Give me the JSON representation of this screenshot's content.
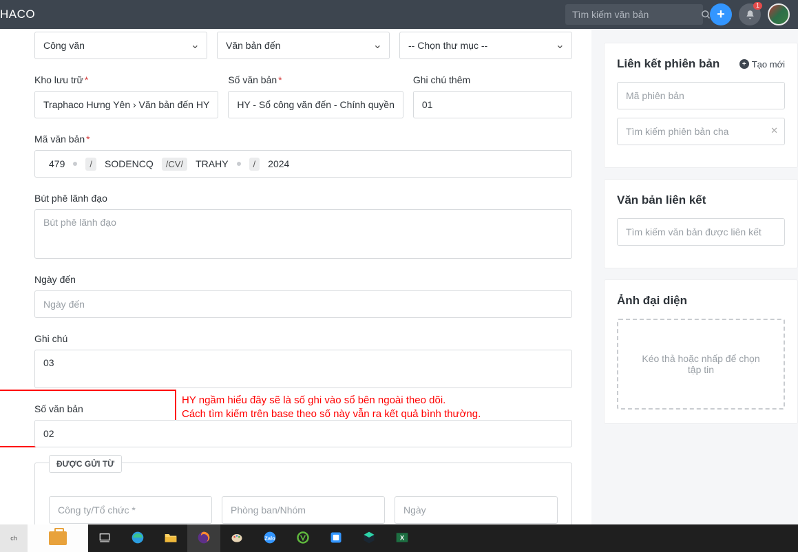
{
  "header": {
    "brand": "HACO",
    "search_placeholder": "Tìm kiếm văn bản",
    "notification_count": "1"
  },
  "form": {
    "type_select": "Công văn",
    "direction_select": "Văn bản đến",
    "folder_placeholder": "-- Chọn thư mục --",
    "storage_label": "Kho lưu trữ",
    "storage_value": "Traphaco Hưng Yên › Văn bản đến HY",
    "docnum_label": "Số văn bản",
    "docnum_value": "HY - Sổ công văn đến - Chính quyền",
    "extra_note_label": "Ghi chú thêm",
    "extra_note_value": "01",
    "code_label": "Mã văn bản",
    "code": {
      "p1": "479",
      "s1": "/",
      "p2": "SODENCQ",
      "s2": "/CV/",
      "p3": "TRAHY",
      "s3": "/",
      "p4": "2024"
    },
    "leader_label": "Bút phê lãnh đạo",
    "leader_placeholder": "Bút phê lãnh đạo",
    "arrival_label": "Ngày đến",
    "arrival_placeholder": "Ngày đến",
    "note_label": "Ghi chú",
    "note_value": "03",
    "svb_label": "Số văn bản",
    "svb_value": "02",
    "sent_from_tab": "ĐƯỢC GỬI TỪ",
    "sent_from_company": "Công ty/Tổ chức *",
    "sent_from_dept": "Phòng ban/Nhóm",
    "sent_from_date": "Ngày"
  },
  "annotation": {
    "line1": "HY ngầm hiểu đây sẽ là số ghi vào sổ bên ngoài theo dõi.",
    "line2": "Cách tìm kiếm trên base theo số này vẫn ra kết quả bình thường."
  },
  "side": {
    "version_title": "Liên kết phiên bản",
    "version_create": "Tạo mới",
    "version_code_ph": "Mã phiên bản",
    "version_parent_ph": "Tìm kiếm phiên bản cha",
    "linked_title": "Văn bản liên kết",
    "linked_search_ph": "Tìm kiếm văn bản được liên kết",
    "avatar_title": "Ảnh đại diện",
    "dropzone_text": "Kéo thả hoặc nhấp để chọn tập tin"
  },
  "taskbar": {
    "start": "ch"
  }
}
